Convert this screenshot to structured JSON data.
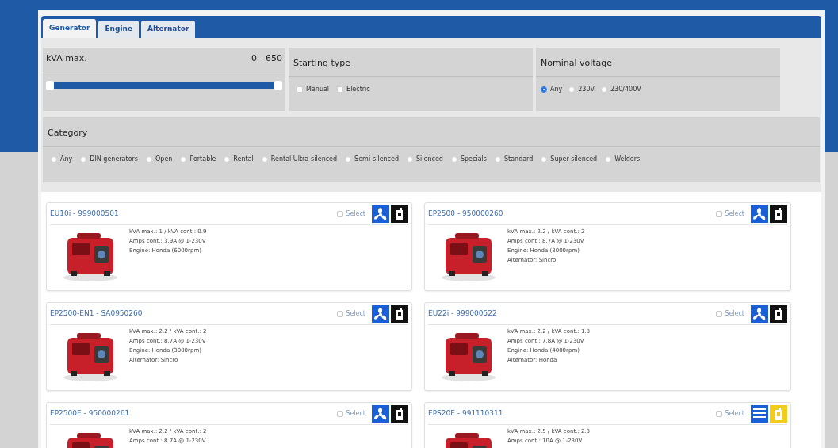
{
  "tabs": [
    {
      "label": "Generator",
      "selected": true
    },
    {
      "label": "Engine",
      "selected": false
    },
    {
      "label": "Alternator",
      "selected": false
    }
  ],
  "kva_filter": {
    "title": "kVA max.",
    "range": "0 - 650",
    "level": 1
  },
  "starting_type": {
    "title": "Starting type",
    "options": [
      {
        "label": "Manual",
        "checked": false
      },
      {
        "label": "Electric",
        "checked": false
      }
    ]
  },
  "nominal_voltage": {
    "title": "Nominal voltage",
    "options": [
      {
        "label": "Any",
        "selected": true
      },
      {
        "label": "230V",
        "selected": false
      },
      {
        "label": "230/400V",
        "selected": false
      }
    ]
  },
  "category": {
    "title": "Category",
    "options": [
      {
        "label": "Any",
        "checked": false
      },
      {
        "label": "DIN generators",
        "checked": false
      },
      {
        "label": "Open",
        "checked": false
      },
      {
        "label": "Portable",
        "checked": false
      },
      {
        "label": "Rental",
        "checked": false
      },
      {
        "label": "Rental Ultra-silenced",
        "checked": false
      },
      {
        "label": "Semi-silenced",
        "checked": false
      },
      {
        "label": "Silenced",
        "checked": false
      },
      {
        "label": "Specials",
        "checked": false
      },
      {
        "label": "Standard",
        "checked": false
      },
      {
        "label": "Super-silenced",
        "checked": false
      },
      {
        "label": "Welders",
        "checked": false
      }
    ]
  },
  "products": [
    {
      "title": "EU10i - 999000501",
      "select_label": "Select",
      "checked": false,
      "icons": [
        {
          "kind": "fan",
          "color": "#1a5fd6"
        },
        {
          "kind": "fuel",
          "color": "#111111"
        }
      ],
      "specs": [
        "kVA max.: 1 / kVA cont.: 0.9",
        "Amps cont.: 3.9A @ 1-230V",
        "Engine: Honda (6000rpm)"
      ]
    },
    {
      "title": "EP2500 - 950000260",
      "select_label": "Select",
      "checked": false,
      "icons": [
        {
          "kind": "fan",
          "color": "#1a5fd6"
        },
        {
          "kind": "fuel",
          "color": "#111111"
        }
      ],
      "specs": [
        "kVA max.: 2.2 / kVA cont.: 2",
        "Amps cont.: 8.7A @ 1-230V",
        "Engine: Honda (3000rpm)",
        "Alternator: Sincro"
      ]
    },
    {
      "title": "EP2500-EN1 - SA0950260",
      "select_label": "Select",
      "checked": false,
      "icons": [
        {
          "kind": "fan",
          "color": "#1a5fd6"
        },
        {
          "kind": "fuel",
          "color": "#111111"
        }
      ],
      "specs": [
        "kVA max.: 2.2 / kVA cont.: 2",
        "Amps cont.: 8.7A @ 1-230V",
        "Engine: Honda (3000rpm)",
        "Alternator: Sincro"
      ]
    },
    {
      "title": "EU22i - 999000522",
      "select_label": "Select",
      "checked": false,
      "icons": [
        {
          "kind": "fan",
          "color": "#1a5fd6"
        },
        {
          "kind": "fuel",
          "color": "#111111"
        }
      ],
      "specs": [
        "kVA max.: 2.2 / kVA cont.: 1.8",
        "Amps cont.: 7.8A @ 1-230V",
        "Engine: Honda (4000rpm)",
        "Alternator: Honda"
      ]
    },
    {
      "title": "EP2500E - 950000261",
      "select_label": "Select",
      "checked": false,
      "icons": [
        {
          "kind": "fan",
          "color": "#1a5fd6"
        },
        {
          "kind": "fuel",
          "color": "#111111"
        }
      ],
      "specs": [
        "kVA max.: 2.2 / kVA cont.: 2",
        "Amps cont.: 8.7A @ 1-230V"
      ]
    },
    {
      "title": "EPS20E - 991110311",
      "select_label": "Select",
      "checked": false,
      "icons": [
        {
          "kind": "radiator",
          "color": "#1a5fd6"
        },
        {
          "kind": "fuel",
          "color": "#f2cc1c"
        }
      ],
      "specs": [
        "kVA max.: 2.5 / kVA cont.: 2.3",
        "Amps cont.: 10A @ 1-230V"
      ]
    }
  ]
}
